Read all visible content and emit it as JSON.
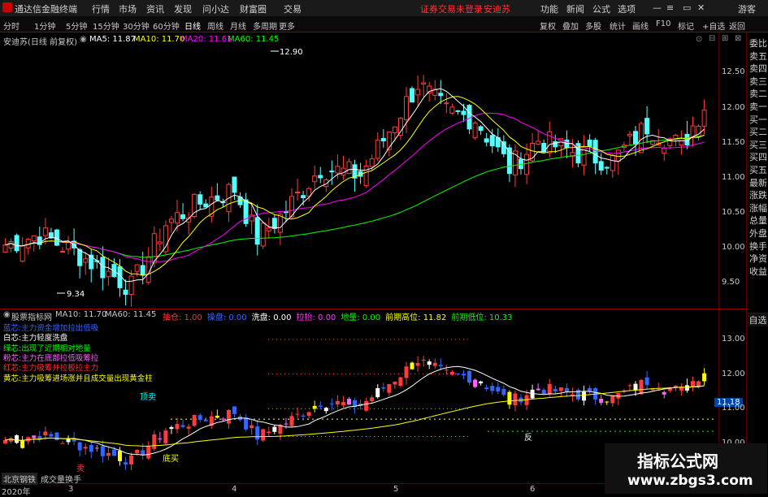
{
  "titlebar": {
    "app_title": "通达信金融终端",
    "menu": [
      "行情",
      "市场",
      "资讯",
      "发现",
      "问小达",
      "财富圈",
      "交易"
    ],
    "login_status": "证券交易未登录",
    "stock_name": "安迪苏",
    "right_menu": [
      "功能",
      "新闻",
      "公式",
      "选项"
    ],
    "guest": "游客"
  },
  "periods": {
    "items": [
      "分时",
      "1分钟",
      "5分钟",
      "15分钟",
      "30分钟",
      "60分钟",
      "日线",
      "周线",
      "月线",
      "多周期",
      "更多"
    ],
    "active": "日线"
  },
  "toolbar": [
    "复权",
    "叠加",
    "多股",
    "统计",
    "画线",
    "F10",
    "标记",
    "+自选",
    "返回"
  ],
  "main_chart": {
    "label": "安迪苏(日线 前复权)",
    "ma5_label": "MA5: 11.87",
    "ma10_label": "MA10: 11.70",
    "ma20_label": "MA20: 11.61",
    "ma60_label": "MA60: 11.45",
    "ma5_color": "#ffffff",
    "ma10_color": "#ffff00",
    "ma20_color": "#ff00ff",
    "ma60_color": "#00ff00",
    "high_mark": "12.90",
    "low_mark": "9.34",
    "axis": [
      "12.50",
      "12.00",
      "11.50",
      "11.00",
      "10.50",
      "10.00",
      "9.50"
    ]
  },
  "indicator": {
    "label": "股票指标网",
    "ma10": "MA10: 11.70",
    "ma60": "MA60: 11.45",
    "fields": [
      {
        "label": "抽仓:",
        "value": "1.00",
        "color": "#ff3333"
      },
      {
        "label": "操盘:",
        "value": "0.00",
        "color": "#3366ff"
      },
      {
        "label": "洗盘:",
        "value": "0.00",
        "color": "#ffffff"
      },
      {
        "label": "拉抬:",
        "value": "0.00",
        "color": "#ff33ff"
      },
      {
        "label": "地量:",
        "value": "0.00",
        "color": "#00ff00"
      },
      {
        "label": "前期高位:",
        "value": "11.82",
        "color": "#ffff00"
      },
      {
        "label": "前期低位:",
        "value": "10.33",
        "color": "#00ff00"
      }
    ],
    "legend": [
      {
        "text": "蓝芯:主力资金增加拉出低吸",
        "color": "#3366ff"
      },
      {
        "text": "白芯:主力轻度洗盘",
        "color": "#ffffff"
      },
      {
        "text": "绿芯:出现了近期相对地量",
        "color": "#00ff00"
      },
      {
        "text": "粉芯:主力在底部拉低吸筹拉",
        "color": "#ff66ff"
      },
      {
        "text": "红芯:主力吸筹并拉板拉主力",
        "color": "#ff3333"
      },
      {
        "text": "黄芯:主力吸筹进场涨并且成交量出现黄金柱",
        "color": "#ffff00"
      }
    ],
    "axis": [
      "13.00",
      "12.00",
      "11.18",
      "11.00",
      "10.00"
    ],
    "current_price": "11.18",
    "markers": {
      "top": "顶卖",
      "buy": "底买",
      "sell": "卖",
      "reverse": "反"
    }
  },
  "date_axis": {
    "year": "2020年",
    "ticks": [
      "3",
      "4",
      "5",
      "6"
    ]
  },
  "bottom_tabs": [
    "北京钢铁",
    "成交量换手"
  ],
  "right_panel": [
    "委比",
    "卖五",
    "卖四",
    "卖三",
    "卖二",
    "卖一",
    "买一",
    "买二",
    "买三",
    "买四",
    "买五",
    "最新",
    "涨跌",
    "涨幅",
    "总量",
    "外盘",
    "换手",
    "净资",
    "收益"
  ],
  "right_panel_extra": "自选",
  "watermark": {
    "title": "指标公式网",
    "url": "www.zbgs3.com"
  }
}
